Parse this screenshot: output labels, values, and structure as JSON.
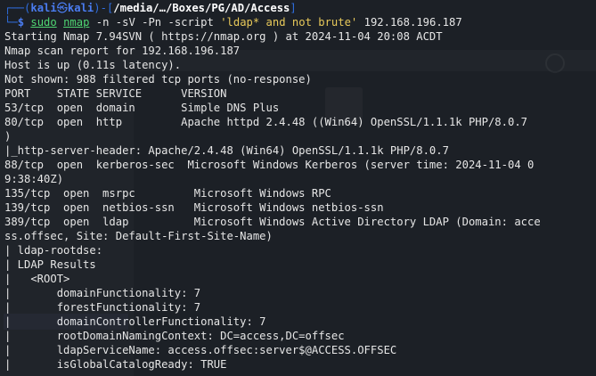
{
  "prompt": {
    "frame_top": "┌──(",
    "user": "kali",
    "skull": "㉿",
    "host": "kali",
    "sep": ")-[",
    "path": "/media/…/Boxes/PG/AD/Access",
    "close": "]",
    "frame_bottom": "└─",
    "dollar": "$ ",
    "sudo": "sudo",
    "nmap": "nmap",
    "args": " -n -sV -Pn -script ",
    "script_arg": "'ldap* and not brute'",
    "target": " 192.168.196.187"
  },
  "output": [
    "Starting Nmap 7.94SVN ( https://nmap.org ) at 2024-11-04 20:08 ACDT",
    "Nmap scan report for 192.168.196.187",
    "Host is up (0.11s latency).",
    "Not shown: 988 filtered tcp ports (no-response)",
    "PORT    STATE SERVICE      VERSION",
    "53/tcp  open  domain       Simple DNS Plus",
    "80/tcp  open  http         Apache httpd 2.4.48 ((Win64) OpenSSL/1.1.1k PHP/8.0.7",
    ")",
    "|_http-server-header: Apache/2.4.48 (Win64) OpenSSL/1.1.1k PHP/8.0.7",
    "88/tcp  open  kerberos-sec  Microsoft Windows Kerberos (server time: 2024-11-04 0",
    "9:38:40Z)",
    "135/tcp  open  msrpc         Microsoft Windows RPC",
    "139/tcp  open  netbios-ssn   Microsoft Windows netbios-ssn",
    "389/tcp  open  ldap          Microsoft Windows Active Directory LDAP (Domain: acce",
    "ss.offsec, Site: Default-First-Site-Name)",
    "| ldap-rootdse:",
    "| LDAP Results",
    "|   <ROOT>",
    "|       domainFunctionality: 7",
    "|       forestFunctionality: 7",
    "|       domainControllerFunctionality: 7",
    "|       rootDomainNamingContext: DC=access,DC=offsec",
    "|       ldapServiceName: access.offsec:server$@ACCESS.OFFSEC",
    "|       isGlobalCatalogReady: TRUE"
  ]
}
